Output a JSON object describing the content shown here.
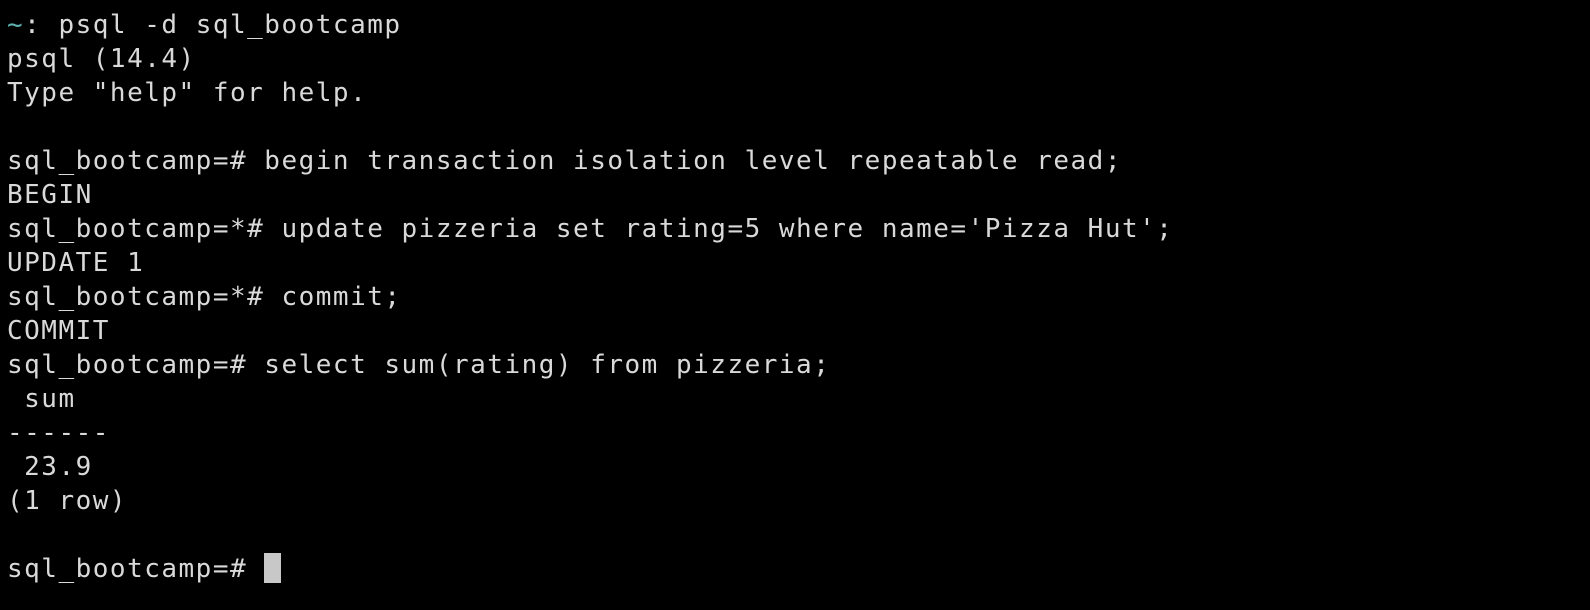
{
  "terminal": {
    "colors": {
      "background": "#000000",
      "foreground": "#d9d9d9",
      "tilde": "#5fafaf",
      "cursor": "#c8c8c8"
    },
    "first_line": {
      "tilde": "~",
      "text": ": psql -d sql_bootcamp"
    },
    "lines": [
      "psql (14.4)",
      "Type \"help\" for help.",
      "",
      "sql_bootcamp=# begin transaction isolation level repeatable read;",
      "BEGIN",
      "sql_bootcamp=*# update pizzeria set rating=5 where name='Pizza Hut';",
      "UPDATE 1",
      "sql_bootcamp=*# commit;",
      "COMMIT",
      "sql_bootcamp=# select sum(rating) from pizzeria;",
      " sum",
      "------",
      " 23.9",
      "(1 row)",
      ""
    ],
    "prompt": "sql_bootcamp=# "
  }
}
